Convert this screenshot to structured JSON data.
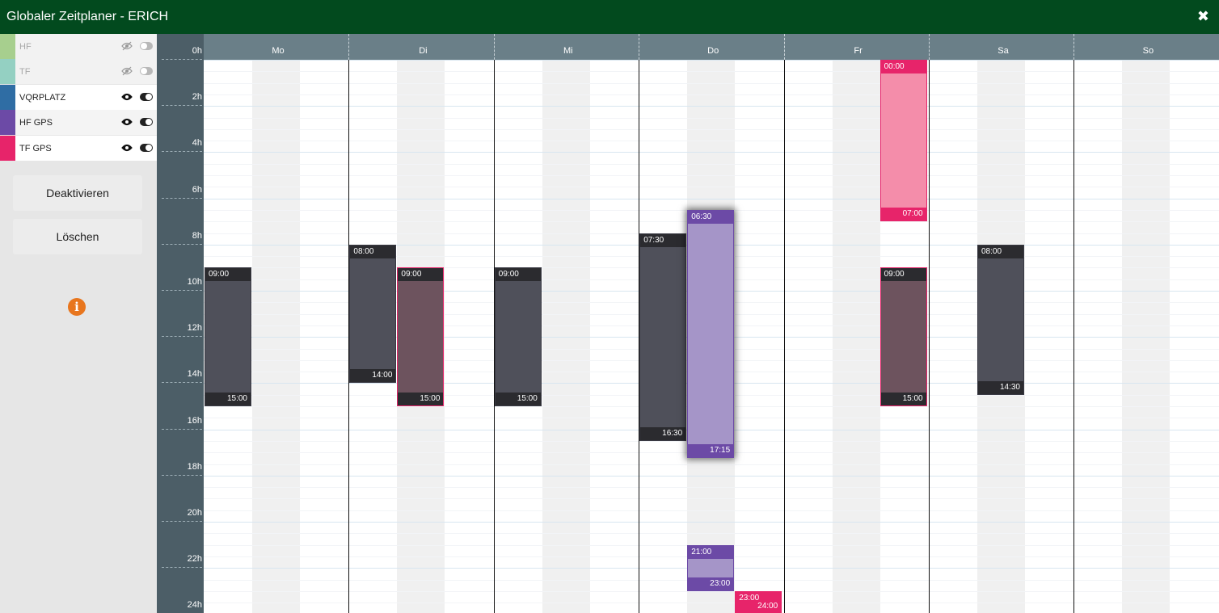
{
  "window": {
    "title": "Globaler Zeitplaner - ERICH",
    "close_glyph": "✖"
  },
  "layers": [
    {
      "label": "HF",
      "color": "#a7cf8e",
      "visible": false,
      "enabled": false,
      "eye_icon": "eye-slash-icon"
    },
    {
      "label": "TF",
      "color": "#94d0c2",
      "visible": false,
      "enabled": false,
      "eye_icon": "eye-slash-icon"
    },
    {
      "label": "VQRPLATZ",
      "color": "#2f6da4",
      "visible": true,
      "enabled": true,
      "eye_icon": "eye-icon"
    },
    {
      "label": "HF GPS",
      "color": "#6c4aa6",
      "visible": true,
      "enabled": true,
      "eye_icon": "eye-icon"
    },
    {
      "label": "TF GPS",
      "color": "#e7246a",
      "visible": true,
      "enabled": true,
      "eye_icon": "eye-icon"
    }
  ],
  "actions": {
    "deactivate": "Deaktivieren",
    "delete": "Löschen",
    "info_glyph": "i"
  },
  "hours": [
    "0h",
    "2h",
    "4h",
    "6h",
    "8h",
    "10h",
    "12h",
    "14h",
    "16h",
    "18h",
    "20h",
    "22h",
    "24h"
  ],
  "days": [
    "Mo",
    "Di",
    "Mi",
    "Do",
    "Fr",
    "Sa",
    "So"
  ],
  "colors": {
    "vqrplatz_block": "#4f505a",
    "vqrplatz_head": "#2b2b2f",
    "hf_gps_block": "#a595c8",
    "hf_gps_head": "#6c4aa6",
    "tf_gps_block": "#f48daa",
    "tf_gps_head": "#e7246a",
    "overlap_block": "#6d535e",
    "overlap_head": "#2b2b2f"
  },
  "blocks": [
    {
      "day": "Mo",
      "lane": 0,
      "start": "09:00",
      "end": "15:00",
      "layer": "VQRPLATZ",
      "style": "vqrplatz"
    },
    {
      "day": "Di",
      "lane": 0,
      "start": "08:00",
      "end": "14:00",
      "layer": "VQRPLATZ",
      "style": "vqrplatz"
    },
    {
      "day": "Di",
      "lane": 1,
      "start": "09:00",
      "end": "15:00",
      "layer": "TF GPS",
      "style": "overlap"
    },
    {
      "day": "Mi",
      "lane": 0,
      "start": "09:00",
      "end": "15:00",
      "layer": "VQRPLATZ",
      "style": "vqrplatz"
    },
    {
      "day": "Do",
      "lane": 0,
      "start": "07:30",
      "end": "16:30",
      "layer": "VQRPLATZ",
      "style": "vqrplatz"
    },
    {
      "day": "Do",
      "lane": 1,
      "start": "06:30",
      "end": "17:15",
      "layer": "HF GPS",
      "style": "hf_gps",
      "selected": true
    },
    {
      "day": "Do",
      "lane": 1,
      "start": "21:00",
      "end": "23:00",
      "layer": "HF GPS",
      "style": "hf_gps"
    },
    {
      "day": "Do",
      "lane": 2,
      "start": "23:00",
      "end": "24:00",
      "layer": "TF GPS",
      "style": "tf_gps"
    },
    {
      "day": "Fr",
      "lane": 2,
      "start": "00:00",
      "end": "07:00",
      "layer": "TF GPS",
      "style": "tf_gps"
    },
    {
      "day": "Fr",
      "lane": 2,
      "start": "09:00",
      "end": "15:00",
      "layer": "TF GPS",
      "style": "overlap"
    },
    {
      "day": "Sa",
      "lane": 1,
      "start": "08:00",
      "end": "14:30",
      "layer": "VQRPLATZ",
      "style": "vqrplatz"
    }
  ]
}
